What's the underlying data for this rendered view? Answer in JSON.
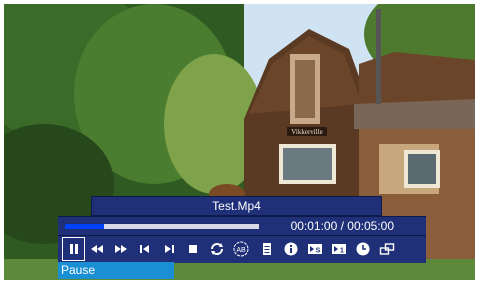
{
  "player": {
    "file_title": "Test.Mp4",
    "time_display": "00:01:00 / 00:05:00",
    "progress_fraction": 0.2,
    "tooltip": "Pause"
  },
  "scene": {
    "sign_text": "Vikkerville"
  },
  "controls": [
    {
      "name": "pause-button",
      "icon": "pause-icon",
      "active": true
    },
    {
      "name": "rewind-button",
      "icon": "rewind-icon"
    },
    {
      "name": "fast-forward-button",
      "icon": "fast-forward-icon"
    },
    {
      "name": "previous-button",
      "icon": "previous-icon"
    },
    {
      "name": "next-button",
      "icon": "next-icon"
    },
    {
      "name": "stop-button",
      "icon": "stop-icon"
    },
    {
      "name": "repeat-button",
      "icon": "repeat-icon"
    },
    {
      "name": "ab-repeat-button",
      "icon": "ab-repeat-icon",
      "label": "AB"
    },
    {
      "name": "playlist-button",
      "icon": "playlist-icon"
    },
    {
      "name": "info-button",
      "icon": "info-icon"
    },
    {
      "name": "subtitle-button",
      "icon": "subtitle-icon",
      "label": "S"
    },
    {
      "name": "audio-track-button",
      "icon": "audio-track-icon",
      "label": "1"
    },
    {
      "name": "timer-button",
      "icon": "clock-icon"
    },
    {
      "name": "aspect-ratio-button",
      "icon": "aspect-ratio-icon"
    }
  ]
}
